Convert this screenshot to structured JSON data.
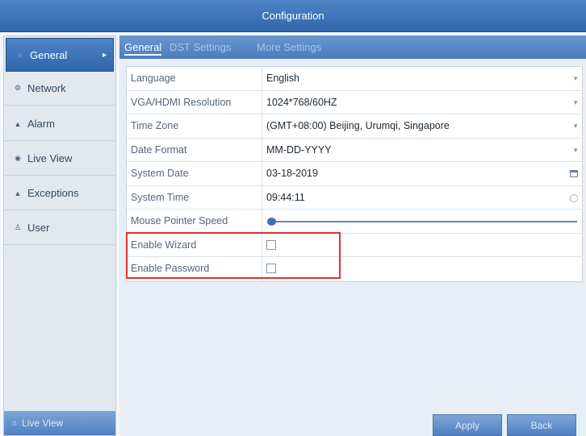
{
  "window": {
    "title": "Configuration"
  },
  "sidebar": {
    "items": [
      {
        "label": "General",
        "icon": "general-icon",
        "active": true
      },
      {
        "label": "Network",
        "icon": "network-icon",
        "active": false
      },
      {
        "label": "Alarm",
        "icon": "alarm-icon",
        "active": false
      },
      {
        "label": "Live View",
        "icon": "live-view-icon",
        "active": false
      },
      {
        "label": "Exceptions",
        "icon": "exceptions-icon",
        "active": false
      },
      {
        "label": "User",
        "icon": "user-icon",
        "active": false
      }
    ],
    "bottom": {
      "label": "Live View",
      "icon": "home-icon"
    }
  },
  "tabs": [
    {
      "label": "General",
      "active": true
    },
    {
      "label": "DST Settings",
      "active": false
    },
    {
      "label": "More Settings",
      "active": false
    }
  ],
  "form": {
    "language": {
      "label": "Language",
      "value": "English"
    },
    "resolution": {
      "label": "VGA/HDMI Resolution",
      "value": "1024*768/60HZ"
    },
    "time_zone": {
      "label": "Time Zone",
      "value": "(GMT+08:00) Beijing, Urumqi, Singapore"
    },
    "date_format": {
      "label": "Date Format",
      "value": "MM-DD-YYYY"
    },
    "system_date": {
      "label": "System Date",
      "value": "03-18-2019"
    },
    "system_time": {
      "label": "System Time",
      "value": "09:44:11"
    },
    "mouse_speed": {
      "label": "Mouse Pointer Speed",
      "level": 0.0
    },
    "enable_wizard": {
      "label": "Enable Wizard",
      "checked": false
    },
    "enable_password": {
      "label": "Enable Password",
      "checked": false
    }
  },
  "buttons": {
    "apply": "Apply",
    "back": "Back"
  },
  "colors": {
    "accent": "#3f75ba",
    "highlight": "#e02f2f"
  }
}
